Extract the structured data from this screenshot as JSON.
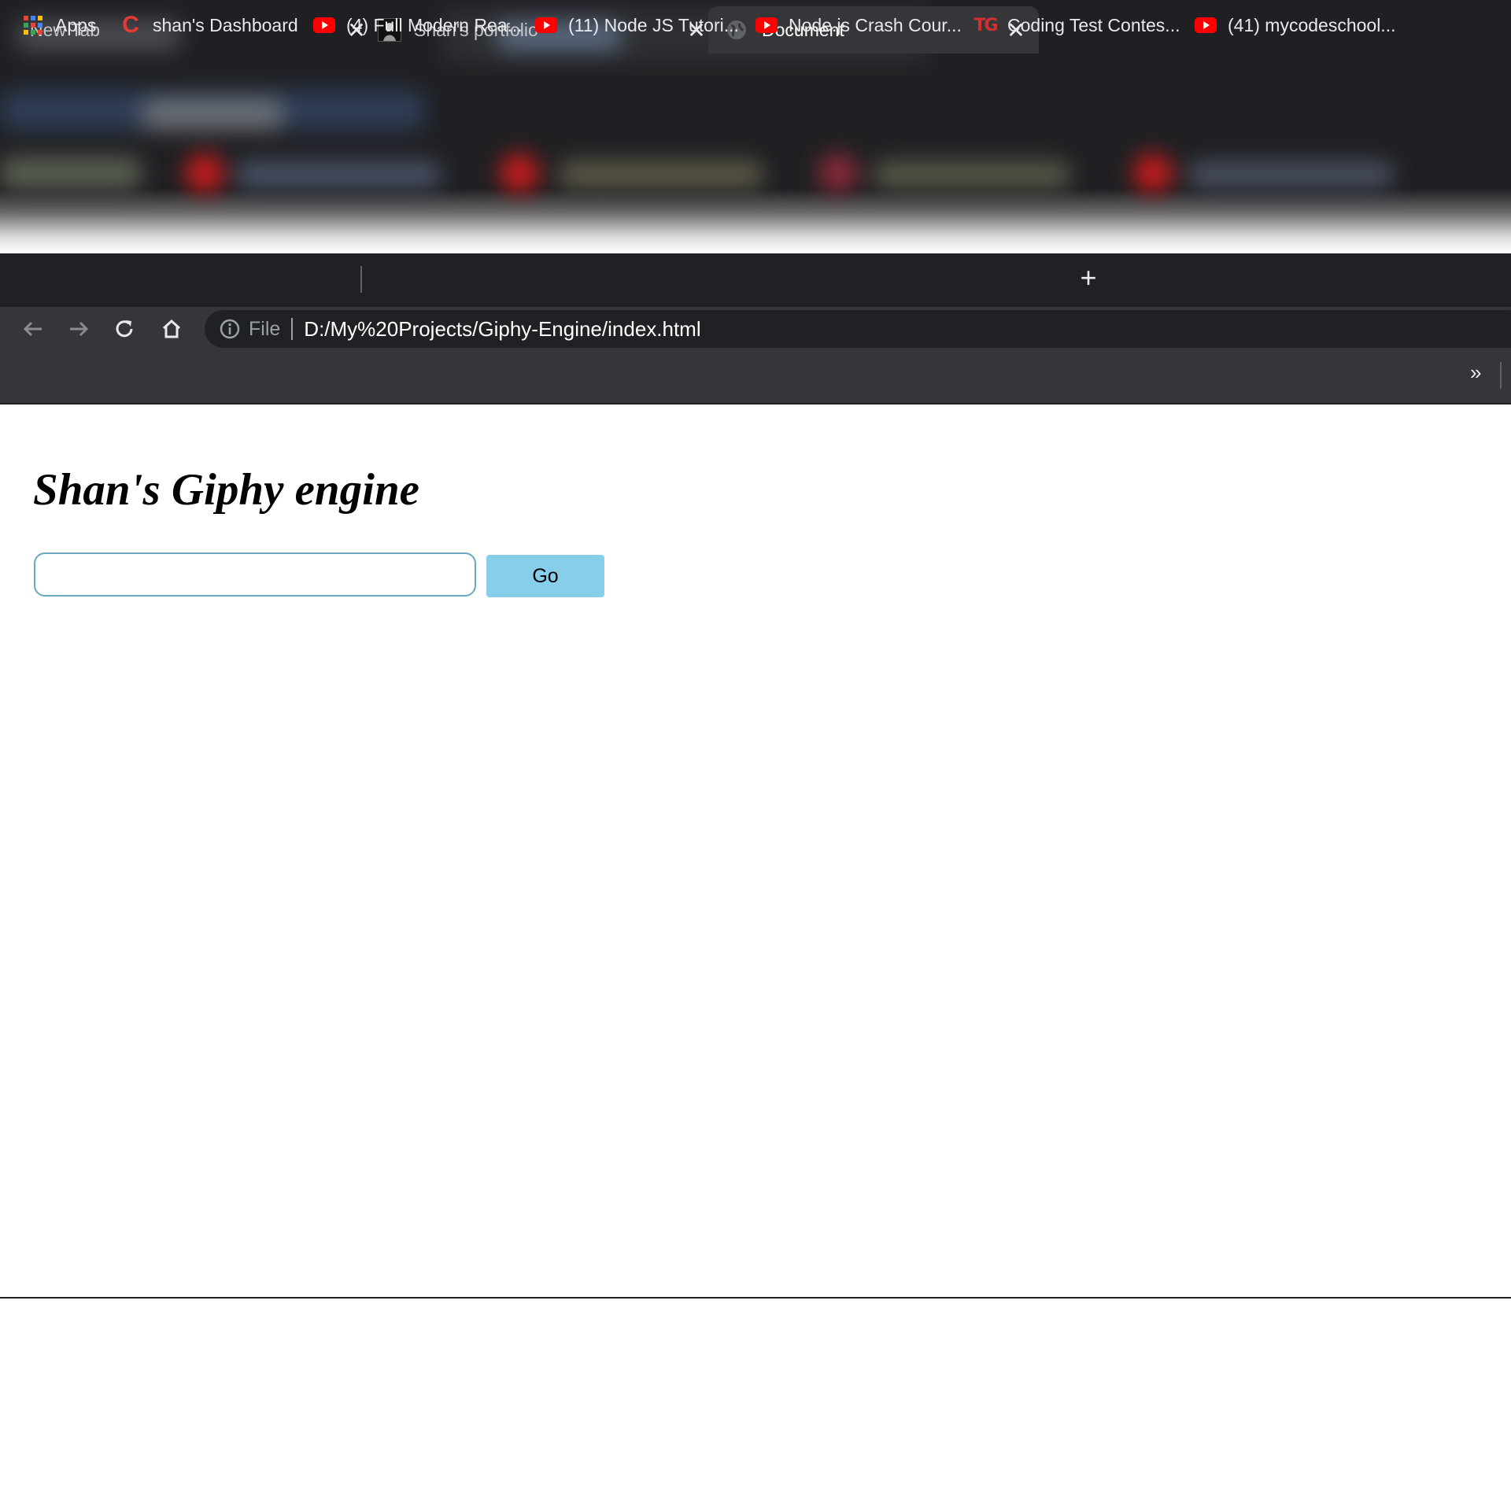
{
  "browser": {
    "tabs": [
      {
        "title": "New Tab",
        "active": false
      },
      {
        "title": "Shan's portfolio",
        "active": false
      },
      {
        "title": "Document",
        "active": true
      }
    ],
    "new_tab_symbol": "+",
    "close_symbol": "✕",
    "address_bar": {
      "scheme_label": "File",
      "url": "D:/My%20Projects/Giphy-Engine/index.html"
    },
    "bookmarks": [
      {
        "label": "Apps",
        "icon": "apps-grid-icon"
      },
      {
        "label": "shan's Dashboard",
        "icon": "c-logo-icon"
      },
      {
        "label": "(4) Full Modern Rea...",
        "icon": "youtube-icon"
      },
      {
        "label": "(11) Node JS Tutori...",
        "icon": "youtube-icon"
      },
      {
        "label": "Node.js Crash Cour...",
        "icon": "youtube-icon"
      },
      {
        "label": "Coding Test Contes...",
        "icon": "tg-logo-icon"
      },
      {
        "label": "(41) mycodeschool...",
        "icon": "youtube-icon"
      }
    ],
    "overflow_symbol": "»"
  },
  "page": {
    "heading": "Shan's Giphy engine",
    "search": {
      "value": "",
      "placeholder": ""
    },
    "go_button": "Go"
  },
  "colors": {
    "chrome_dark": "#202124",
    "chrome_toolbar": "#35363a",
    "button_bg": "#87ceeb",
    "input_border": "#6aa8c0",
    "youtube_red": "#ff0000"
  }
}
